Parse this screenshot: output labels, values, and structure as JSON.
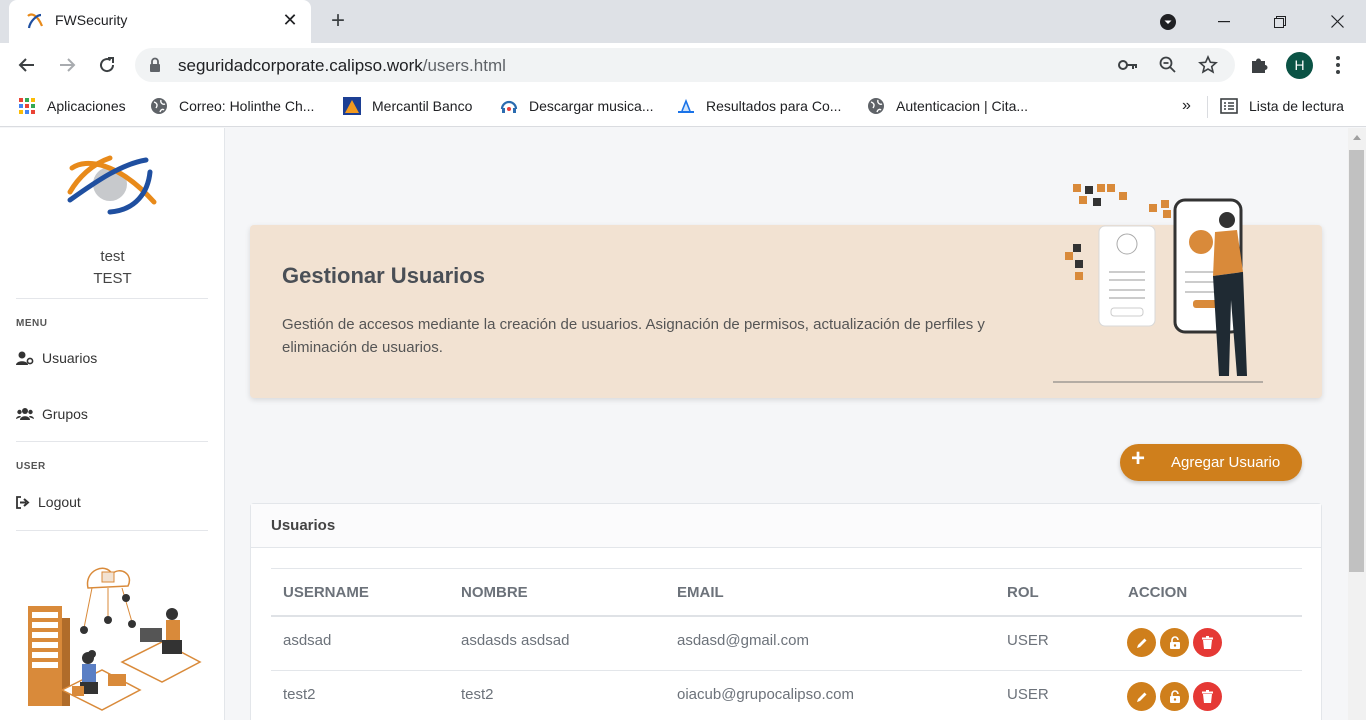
{
  "browser": {
    "tab_title": "FWSecurity",
    "url_host": "seguridadcorporate.calipso.work",
    "url_path": "/users.html",
    "profile_initial": "H",
    "bookmarks": [
      {
        "label": "Aplicaciones",
        "icon": "apps-grid-icon"
      },
      {
        "label": "Correo: Holinthe Ch...",
        "icon": "globe-icon"
      },
      {
        "label": "Mercantil Banco",
        "icon": "mercantil-icon"
      },
      {
        "label": "Descargar musica...",
        "icon": "music-icon"
      },
      {
        "label": "Resultados para Co...",
        "icon": "results-icon"
      },
      {
        "label": "Autenticacion | Cita...",
        "icon": "globe-icon"
      }
    ],
    "more_bookmarks": "»",
    "reading_list": "Lista de lectura"
  },
  "sidebar": {
    "user_name": "test",
    "user_role": "TEST",
    "menu_title": "MENU",
    "menu_items": [
      {
        "label": "Usuarios",
        "icon": "user-cog-icon"
      },
      {
        "label": "Grupos",
        "icon": "users-icon"
      }
    ],
    "user_title": "USER",
    "user_items": [
      {
        "label": "Logout",
        "icon": "sign-out-icon"
      }
    ]
  },
  "hero": {
    "title": "Gestionar Usuarios",
    "description": "Gestión de accesos mediante la creación de usuarios. Asignación de permisos, actualización de perfiles y eliminación de usuarios."
  },
  "add_button": {
    "icon": "plus-icon",
    "label": "Agregar Usuario"
  },
  "users_table": {
    "title": "Usuarios",
    "columns": [
      "USERNAME",
      "NOMBRE",
      "EMAIL",
      "ROL",
      "ACCION"
    ],
    "rows": [
      {
        "username": "asdsad",
        "nombre": "asdasds asdsad",
        "email": "asdasd@gmail.com",
        "rol": "USER"
      },
      {
        "username": "test2",
        "nombre": "test2",
        "email": "oiacub@grupocalipso.com",
        "rol": "USER"
      }
    ],
    "actions": [
      {
        "icon": "edit-pencil-icon",
        "color": "#cf7f1c"
      },
      {
        "icon": "unlock-icon",
        "color": "#cf7f1c"
      },
      {
        "icon": "trash-icon",
        "color": "#e53935"
      }
    ]
  },
  "colors": {
    "accent": "#cf7f1c",
    "danger": "#e53935",
    "hero_bg": "#f2e2d2"
  }
}
